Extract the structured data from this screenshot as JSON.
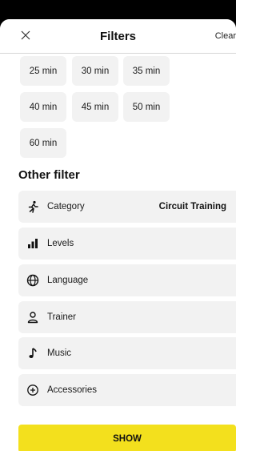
{
  "header": {
    "close_icon": "close-icon",
    "title": "Filters",
    "clear_label": "Clear"
  },
  "durations": [
    "25 min",
    "30 min",
    "35 min",
    "40 min",
    "45 min",
    "50 min",
    "60 min"
  ],
  "other_filter": {
    "title": "Other filter",
    "rows": [
      {
        "icon": "running-person-icon",
        "label": "Category",
        "value": "Circuit Training"
      },
      {
        "icon": "bar-chart-icon",
        "label": "Levels",
        "value": ""
      },
      {
        "icon": "globe-icon",
        "label": "Language",
        "value": ""
      },
      {
        "icon": "person-icon",
        "label": "Trainer",
        "value": ""
      },
      {
        "icon": "music-note-icon",
        "label": "Music",
        "value": ""
      },
      {
        "icon": "plus-circle-icon",
        "label": "Accessories",
        "value": ""
      }
    ]
  },
  "show_label": "SHOW",
  "colors": {
    "accent": "#f3e01d",
    "chip_bg": "#f2f2f2",
    "top_bar": "#000000"
  }
}
